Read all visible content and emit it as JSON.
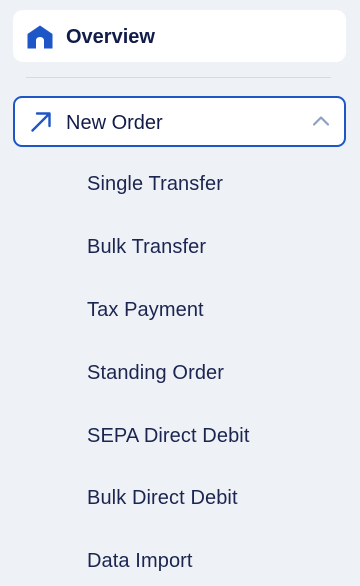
{
  "nav": {
    "overview": {
      "label": "Overview",
      "icon": "home-icon"
    },
    "new_order": {
      "label": "New Order",
      "icon": "arrow-up-right-icon",
      "expand_icon": "chevron-up-icon",
      "expanded": true,
      "items": [
        {
          "label": "Single Transfer"
        },
        {
          "label": "Bulk Transfer"
        },
        {
          "label": "Tax Payment"
        },
        {
          "label": "Standing Order"
        },
        {
          "label": "SEPA Direct Debit"
        },
        {
          "label": "Bulk Direct Debit"
        },
        {
          "label": "Data Import"
        }
      ]
    }
  },
  "colors": {
    "background": "#eef1f5",
    "card": "#ffffff",
    "accent": "#1f56c7",
    "text": "#1b2550",
    "chevron": "#8ea1c4"
  }
}
